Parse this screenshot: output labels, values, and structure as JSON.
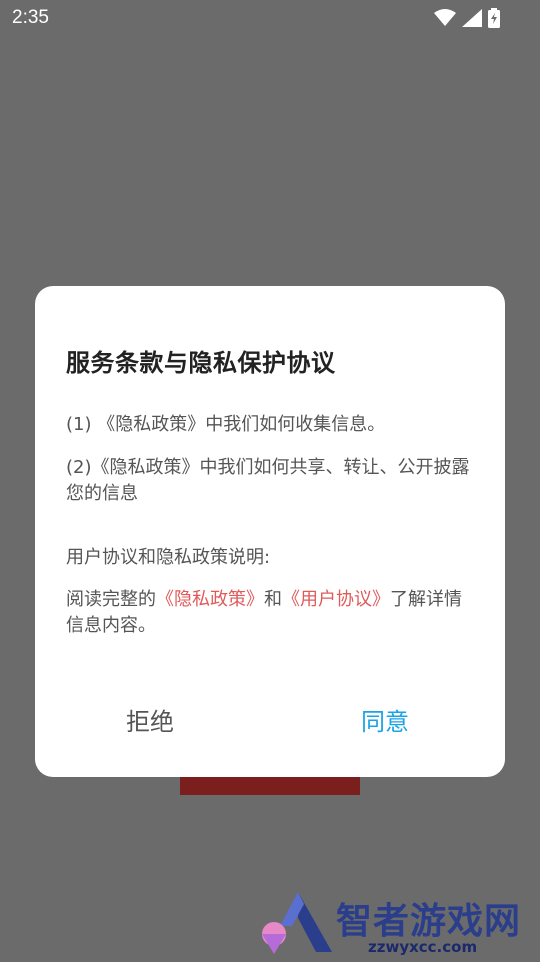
{
  "status_bar": {
    "time": "2:35",
    "icons": [
      "wifi-icon",
      "signal-icon",
      "battery-charging-icon"
    ]
  },
  "dialog": {
    "title": "服务条款与隐私保护协议",
    "item1": "(1) 《隐私政策》中我们如何收集信息。",
    "item2": "(2)《隐私政策》中我们如何共享、转让、公开披露您的信息",
    "notice_heading": "用户协议和隐私政策说明:",
    "read_prefix": "阅读完整的",
    "privacy_link": "《隐私政策》",
    "and_text": "和",
    "user_agreement_link": "《用户协议》",
    "read_suffix": "了解详情信息内容。",
    "reject_label": "拒绝",
    "agree_label": "同意"
  },
  "watermark": {
    "name": "智者游戏网",
    "url": "zzwyxcc.com"
  },
  "colors": {
    "overlay": "#6b6b6b",
    "link": "#e05a5a",
    "agree": "#1aa3e8",
    "reject": "#555555",
    "bg_block": "#7a1e1e"
  }
}
